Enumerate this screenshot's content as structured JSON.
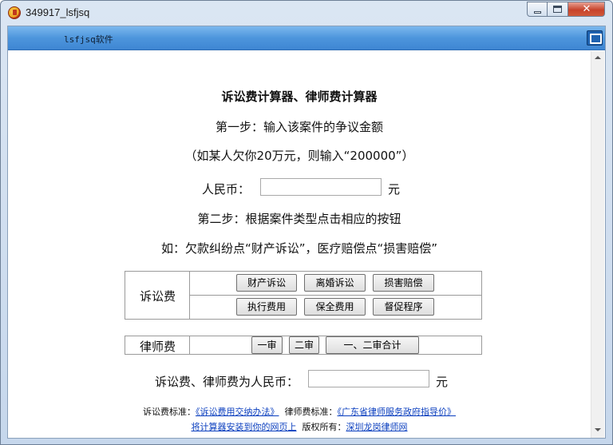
{
  "window": {
    "title": "349917_lsfjsq",
    "icon": "app-icon",
    "controls": [
      "minimize-icon",
      "maximize-icon",
      "close-icon"
    ],
    "close_glyph": "✕"
  },
  "banner": {
    "text": "lsfjsq软件",
    "icon": "window-mode-icon"
  },
  "main": {
    "title": "诉讼费计算器、律师费计算器",
    "step1": "第一步：输入该案件的争议金额",
    "example1": "（如某人欠你20万元，则输入“200000”）",
    "rmb_label": "人民币：",
    "rmb_value": "",
    "rmb_unit": "元",
    "step2": "第二步：根据案件类型点击相应的按钮",
    "example2": "如：欠款纠纷点“财产诉讼”，医疗赔偿点“损害赔偿”"
  },
  "litigation_fee": {
    "label": "诉讼费",
    "buttons": [
      "财产诉讼",
      "离婚诉讼",
      "损害赔偿",
      "执行费用",
      "保全费用",
      "督促程序"
    ]
  },
  "lawyer_fee": {
    "label": "律师费",
    "buttons": [
      "一审",
      "二审",
      "一、二审合计"
    ]
  },
  "result": {
    "label": "诉讼费、律师费为人民币：",
    "value": "",
    "unit": "元"
  },
  "footer": {
    "lit_std_label": "诉讼费标准：",
    "lit_std_link": "《诉讼费用交纳办法》",
    "law_std_label": "律师费标准：",
    "law_std_link": "《广东省律师服务政府指导价》",
    "install_link": "将计算器安装到你的网页上",
    "copyright_label": "版权所有：",
    "copyright_link": "深圳龙岗律师网"
  }
}
